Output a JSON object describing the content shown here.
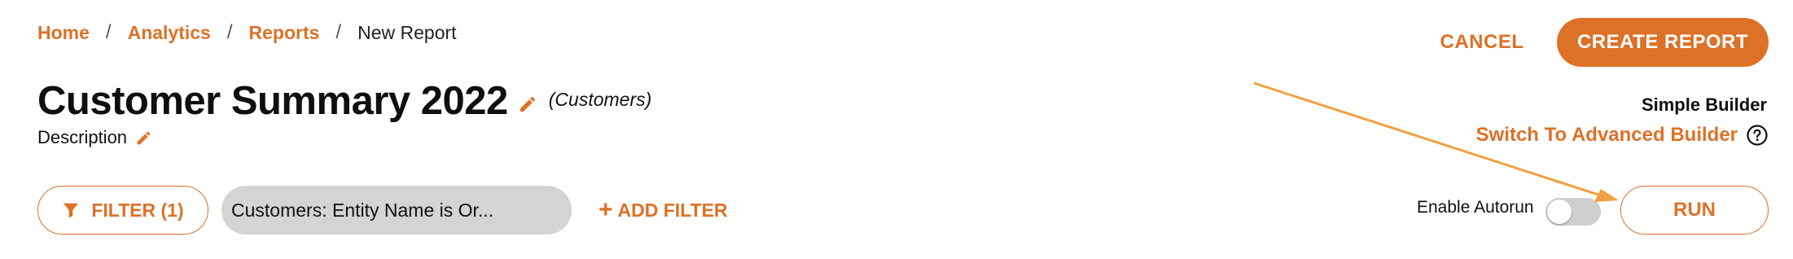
{
  "colors": {
    "accent": "#dd7127",
    "chip_bg": "#d4d4d4",
    "arrow": "#f0a040"
  },
  "breadcrumb": {
    "items": [
      {
        "label": "Home"
      },
      {
        "label": "Analytics"
      },
      {
        "label": "Reports"
      }
    ],
    "current": "New Report",
    "separator": "/"
  },
  "header": {
    "title": "Customer Summary 2022",
    "entity": "(Customers)",
    "description_label": "Description",
    "cancel_label": "CANCEL",
    "create_label": "CREATE REPORT"
  },
  "builder": {
    "mode_label": "Simple Builder",
    "switch_label": "Switch To Advanced Builder"
  },
  "filters": {
    "button_label": "FILTER (1)",
    "active": [
      "Customers: Entity Name is Or..."
    ],
    "add_label": "ADD FILTER"
  },
  "run": {
    "autorun_label": "Enable Autorun",
    "autorun_enabled": false,
    "run_label": "RUN"
  },
  "icons": {
    "edit": "pencil-icon",
    "help": "help-circle-icon",
    "filter": "funnel-icon",
    "add": "plus-icon"
  }
}
